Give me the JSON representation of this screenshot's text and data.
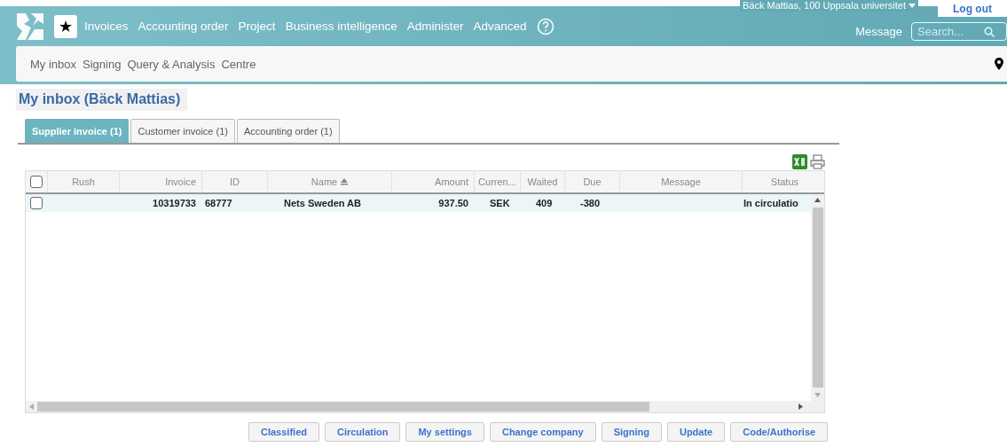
{
  "header": {
    "user_menu": "Bäck Mattias, 100 Uppsala universitet",
    "logout": "Log out",
    "favorite_icon": "★",
    "nav": [
      "Invoices",
      "Accounting order",
      "Project",
      "Business intelligence",
      "Administer",
      "Advanced"
    ],
    "message": "Message",
    "search": {
      "placeholder": "Search..."
    },
    "subnav": [
      "My inbox",
      "Signing",
      "Query & Analysis",
      "Centre"
    ]
  },
  "page_title": "My inbox (Bäck Mattias)",
  "tabs": [
    {
      "label": "Supplier invoice (1)",
      "selected": true
    },
    {
      "label": "Customer invoice (1)",
      "selected": false
    },
    {
      "label": "Accounting order (1)",
      "selected": false
    }
  ],
  "table": {
    "all_checked": false,
    "columns": [
      {
        "label": "Rush",
        "sorted": false
      },
      {
        "label": "Invoice",
        "sorted": false
      },
      {
        "label": "ID",
        "sorted": false
      },
      {
        "label": "Name",
        "sorted": true
      },
      {
        "label": "Amount",
        "sorted": false
      },
      {
        "label": "Curren...",
        "sorted": false
      },
      {
        "label": "Waited",
        "sorted": false
      },
      {
        "label": "Due",
        "sorted": false
      },
      {
        "label": "Message",
        "sorted": false
      },
      {
        "label": "Status",
        "sorted": false
      }
    ],
    "rows": [
      {
        "checked": false,
        "cells": [
          "",
          "10319733",
          "68777",
          "Nets Sweden AB",
          "937.50",
          "SEK",
          "409",
          "-380",
          "",
          "In circulatio"
        ]
      }
    ]
  },
  "buttons": [
    "Classified",
    "Circulation",
    "My settings",
    "Change company",
    "Signing",
    "Update",
    "Code/Authorise"
  ]
}
